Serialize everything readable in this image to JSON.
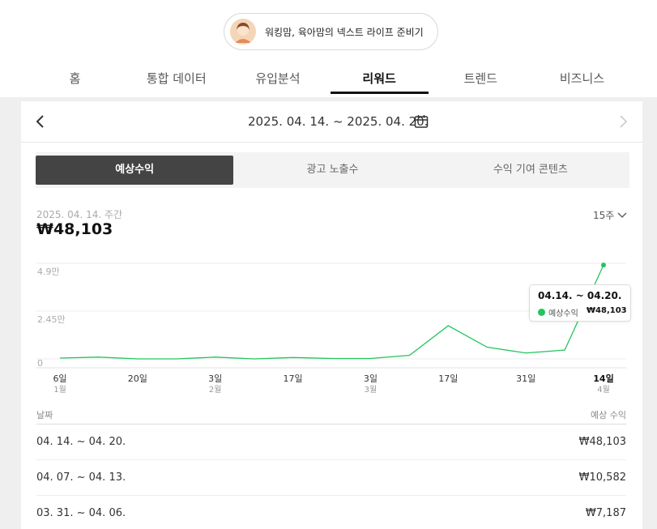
{
  "header": {
    "blog_name": "워킹맘, 육아맘의 넥스트 라이프 준비기",
    "avatar_icon": "profile-avatar"
  },
  "nav": {
    "tabs": [
      {
        "label": "홈",
        "active": false
      },
      {
        "label": "통합 데이터",
        "active": false
      },
      {
        "label": "유입분석",
        "active": false
      },
      {
        "label": "리워드",
        "active": true
      },
      {
        "label": "트렌드",
        "active": false
      },
      {
        "label": "비즈니스",
        "active": false
      }
    ]
  },
  "date_nav": {
    "range": "2025. 04. 14. ~ 2025. 04. 20.",
    "prev_icon": "chevron-left-icon",
    "next_icon": "chevron-right-icon",
    "calendar_icon": "calendar-icon"
  },
  "segments": [
    {
      "label": "예상수익",
      "active": true
    },
    {
      "label": "광고 노출수",
      "active": false
    },
    {
      "label": "수익 기여 콘텐츠",
      "active": false
    }
  ],
  "summary": {
    "week_label": "2025. 04. 14. 주간",
    "value": "₩48,103",
    "period_select": "15주"
  },
  "chart_data": {
    "type": "line",
    "series": [
      {
        "name": "예상수익",
        "color": "#22c55e",
        "values": [
          400,
          900,
          0,
          0,
          900,
          0,
          700,
          200,
          200,
          1800,
          17000,
          6000,
          3000,
          4500,
          48103
        ]
      }
    ],
    "y_ticks": [
      {
        "value": 49000,
        "label": "4.9만"
      },
      {
        "value": 24500,
        "label": "2.45만"
      },
      {
        "value": 0,
        "label": "0"
      }
    ],
    "ylim": [
      0,
      49000
    ],
    "x_ticks": [
      {
        "index": 0,
        "day": "6일",
        "month": "1월"
      },
      {
        "index": 2,
        "day": "20일",
        "month": ""
      },
      {
        "index": 4,
        "day": "3일",
        "month": "2월"
      },
      {
        "index": 6,
        "day": "17일",
        "month": ""
      },
      {
        "index": 8,
        "day": "3일",
        "month": "3월"
      },
      {
        "index": 10,
        "day": "17일",
        "month": ""
      },
      {
        "index": 12,
        "day": "31일",
        "month": ""
      },
      {
        "index": 14,
        "day": "14일",
        "month": "4월",
        "bold": true
      }
    ],
    "tooltip": {
      "title": "04.14. ~ 04.20.",
      "series": "예상수익",
      "value": "₩48,103"
    }
  },
  "table": {
    "headers": {
      "date": "날짜",
      "revenue": "예상 수익"
    },
    "rows": [
      {
        "date": "04. 14. ~ 04. 20.",
        "revenue": "₩48,103"
      },
      {
        "date": "04. 07. ~ 04. 13.",
        "revenue": "₩10,582"
      },
      {
        "date": "03. 31. ~ 04. 06.",
        "revenue": "₩7,187"
      }
    ]
  }
}
